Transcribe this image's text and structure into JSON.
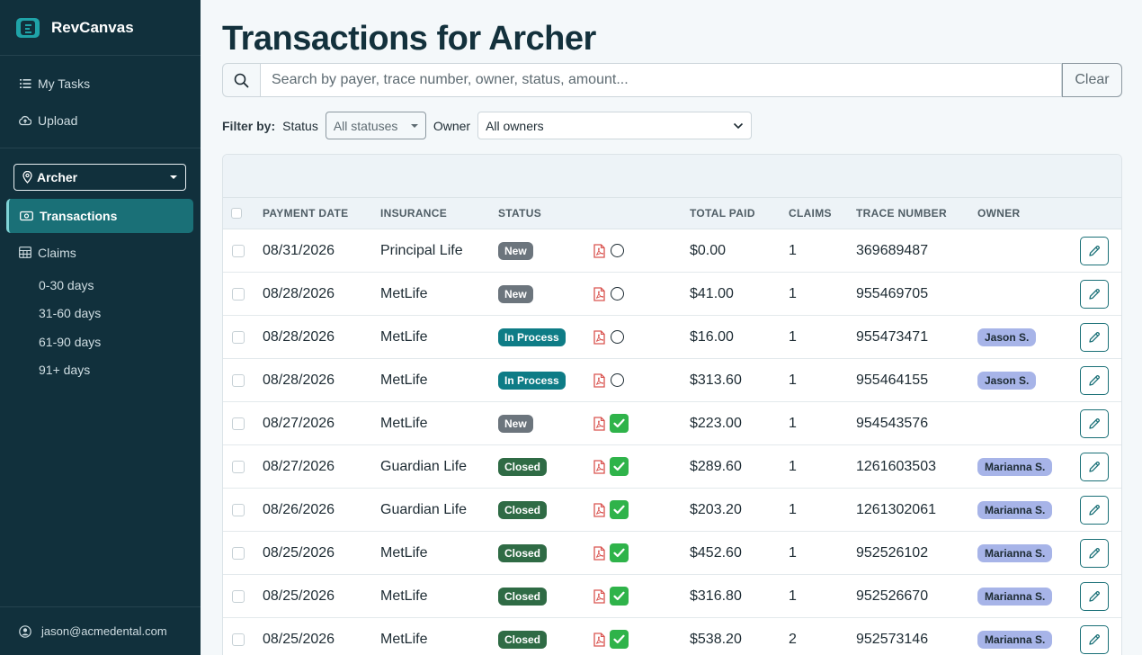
{
  "app": {
    "name": "RevCanvas",
    "user_email": "jason@acmedental.com"
  },
  "sidebar": {
    "top_items": [
      {
        "label": "My Tasks",
        "icon": "list-icon"
      },
      {
        "label": "Upload",
        "icon": "cloud-upload-icon"
      }
    ],
    "location": "Archer",
    "active_item": {
      "label": "Transactions",
      "icon": "cash-icon"
    },
    "claims": {
      "label": "Claims",
      "icon": "table-icon"
    },
    "claims_sub": [
      {
        "label": "0-30 days"
      },
      {
        "label": "31-60 days"
      },
      {
        "label": "61-90 days"
      },
      {
        "label": "91+ days"
      }
    ]
  },
  "page": {
    "title": "Transactions for Archer"
  },
  "search": {
    "placeholder": "Search by payer, trace number, owner, status, amount...",
    "value": "",
    "clear_label": "Clear"
  },
  "filters": {
    "label": "Filter by:",
    "status_label": "Status",
    "status_value": "All statuses",
    "owner_label": "Owner",
    "owner_value": "All owners"
  },
  "table": {
    "columns": [
      "PAYMENT DATE",
      "INSURANCE",
      "STATUS",
      "TOTAL PAID",
      "CLAIMS",
      "TRACE NUMBER",
      "OWNER"
    ],
    "rows": [
      {
        "date": "08/31/2026",
        "insurance": "Principal Life",
        "status": "New",
        "status_color": "#6c757d",
        "complete": false,
        "total": "$0.00",
        "claims": "1",
        "trace": "369689487",
        "owner": ""
      },
      {
        "date": "08/28/2026",
        "insurance": "MetLife",
        "status": "New",
        "status_color": "#6c757d",
        "complete": false,
        "total": "$41.00",
        "claims": "1",
        "trace": "955469705",
        "owner": ""
      },
      {
        "date": "08/28/2026",
        "insurance": "MetLife",
        "status": "In Process",
        "status_color": "#0e7c86",
        "complete": false,
        "total": "$16.00",
        "claims": "1",
        "trace": "955473471",
        "owner": "Jason S."
      },
      {
        "date": "08/28/2026",
        "insurance": "MetLife",
        "status": "In Process",
        "status_color": "#0e7c86",
        "complete": false,
        "total": "$313.60",
        "claims": "1",
        "trace": "955464155",
        "owner": "Jason S."
      },
      {
        "date": "08/27/2026",
        "insurance": "MetLife",
        "status": "New",
        "status_color": "#6c757d",
        "complete": true,
        "total": "$223.00",
        "claims": "1",
        "trace": "954543576",
        "owner": ""
      },
      {
        "date": "08/27/2026",
        "insurance": "Guardian Life",
        "status": "Closed",
        "status_color": "#2f6b45",
        "complete": true,
        "total": "$289.60",
        "claims": "1",
        "trace": "1261603503",
        "owner": "Marianna S."
      },
      {
        "date": "08/26/2026",
        "insurance": "Guardian Life",
        "status": "Closed",
        "status_color": "#2f6b45",
        "complete": true,
        "total": "$203.20",
        "claims": "1",
        "trace": "1261302061",
        "owner": "Marianna S."
      },
      {
        "date": "08/25/2026",
        "insurance": "MetLife",
        "status": "Closed",
        "status_color": "#2f6b45",
        "complete": true,
        "total": "$452.60",
        "claims": "1",
        "trace": "952526102",
        "owner": "Marianna S."
      },
      {
        "date": "08/25/2026",
        "insurance": "MetLife",
        "status": "Closed",
        "status_color": "#2f6b45",
        "complete": true,
        "total": "$316.80",
        "claims": "1",
        "trace": "952526670",
        "owner": "Marianna S."
      },
      {
        "date": "08/25/2026",
        "insurance": "MetLife",
        "status": "Closed",
        "status_color": "#2f6b45",
        "complete": true,
        "total": "$538.20",
        "claims": "2",
        "trace": "952573146",
        "owner": "Marianna S."
      }
    ]
  },
  "colors": {
    "sidebar_bg": "#11303c",
    "accent": "#1a7077",
    "owner_badge": "#a7b4e8",
    "check_green": "#2fb34a",
    "pdf_red": "#d9534f"
  }
}
